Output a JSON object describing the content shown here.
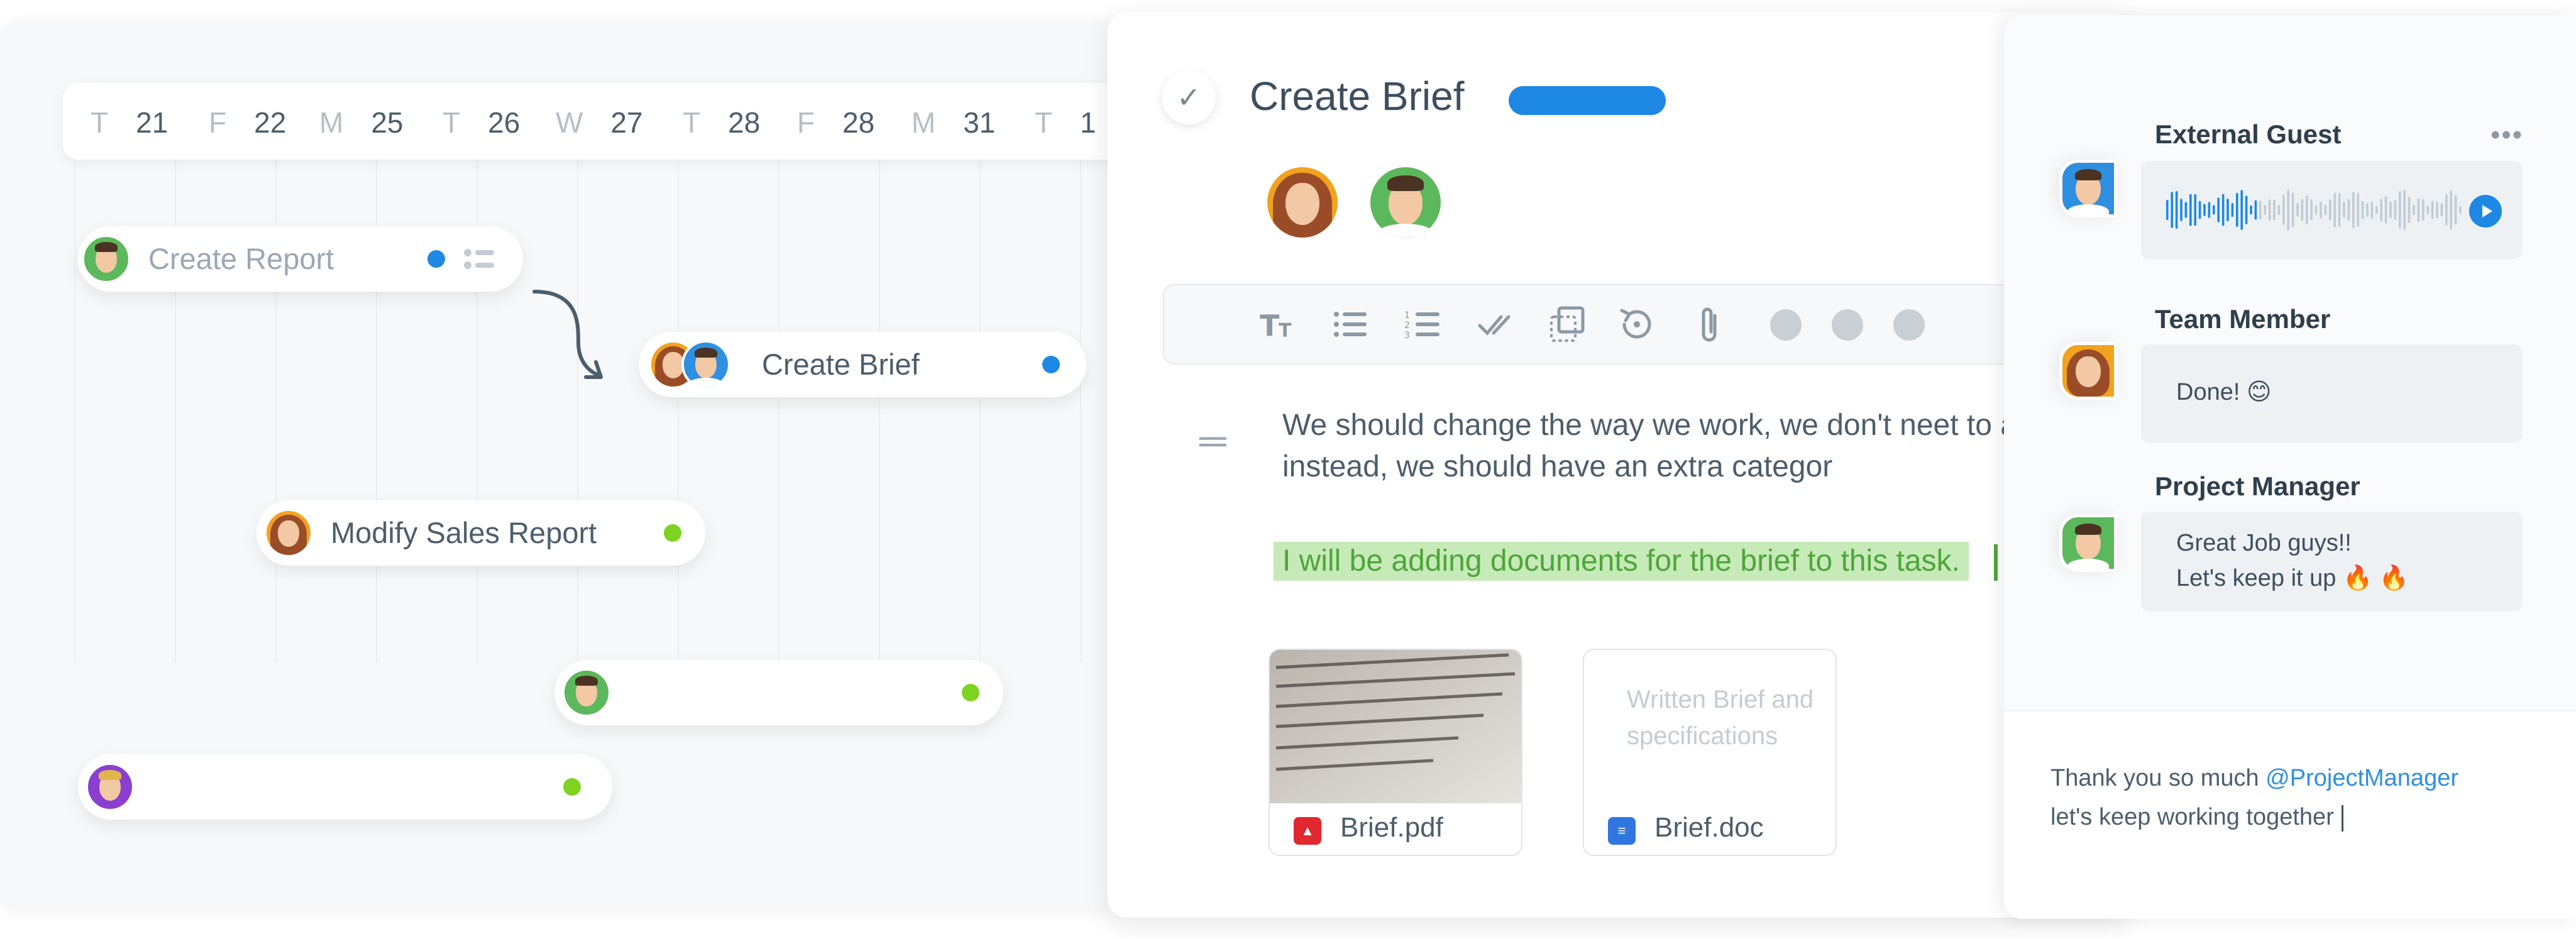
{
  "timeline": {
    "dates": [
      {
        "dow": "T",
        "day": "21"
      },
      {
        "dow": "F",
        "day": "22"
      },
      {
        "dow": "M",
        "day": "25"
      },
      {
        "dow": "T",
        "day": "26"
      },
      {
        "dow": "W",
        "day": "27"
      },
      {
        "dow": "T",
        "day": "28"
      },
      {
        "dow": "F",
        "day": "28"
      },
      {
        "dow": "M",
        "day": "31"
      },
      {
        "dow": "T",
        "day": "1"
      }
    ],
    "tasks": [
      {
        "label": "Create Report"
      },
      {
        "label": "Create Brief"
      },
      {
        "label": "Modify Sales Report"
      },
      {
        "label": ""
      },
      {
        "label": ""
      }
    ]
  },
  "detail": {
    "title": "Create Brief",
    "status_color": "#1e88e5",
    "toolbar_icons": [
      "text-size-icon",
      "bulleted-list-icon",
      "numbered-list-icon",
      "double-check-icon",
      "copy-icon",
      "history-icon",
      "attachment-icon",
      "more-icon"
    ],
    "paragraph": "We should change the way we work, we don't neet to as a priority, instead, we should have an extra categor",
    "highlight": "I will be adding documents for the brief to this task.",
    "attachments": [
      {
        "name": "Brief.pdf",
        "icon": "pdf-icon"
      },
      {
        "name": "Brief.doc",
        "icon": "doc-icon",
        "preview": "Written Brief and specifications"
      }
    ]
  },
  "chat": {
    "messages": [
      {
        "author": "External Guest",
        "type": "voice"
      },
      {
        "author": "Team Member",
        "text": "Done! 😊"
      },
      {
        "author": "Project Manager",
        "lines": [
          "Great Job guys!!",
          "Let's keep it up 🔥 🔥"
        ]
      }
    ],
    "compose": {
      "line1_prefix": "Thank you so much ",
      "mention": "@ProjectManager",
      "line2": "let's keep working together"
    }
  },
  "colors": {
    "accent": "#1e88e5",
    "success": "#7ed321",
    "highlight_bg": "#c6eab8"
  }
}
